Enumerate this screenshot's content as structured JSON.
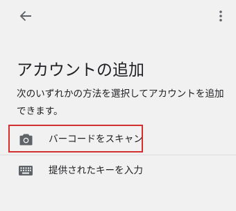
{
  "header": {
    "back_icon": "arrow-left-icon",
    "menu_icon": "more-vert-icon"
  },
  "title": "アカウントの追加",
  "description": "次のいずれかの方法を選択してアカウントを追加できます。",
  "options": [
    {
      "label": "バーコードをスキャン",
      "icon": "camera-icon"
    },
    {
      "label": "提供されたキーを入力",
      "icon": "keyboard-icon"
    }
  ],
  "colors": {
    "background": "#f1f1f1",
    "text": "#202124",
    "icon": "#5f6368",
    "highlight": "#d32f2f"
  }
}
